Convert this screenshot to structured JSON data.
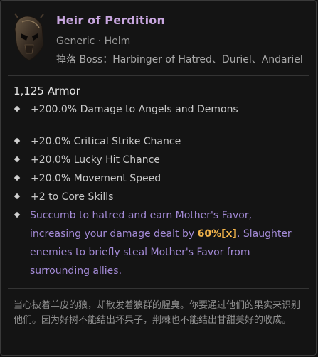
{
  "item": {
    "name": "Heir of Perdition",
    "type_line": "Generic · Helm",
    "drops_line": "掉落 Boss：Harbinger of Hatred、Duriel、Andariel",
    "icon": "helm-icon"
  },
  "stats": {
    "armor": "1,125 Armor",
    "implicit": "+200.0% Damage to Angels and Demons",
    "affixes": [
      "+20.0% Critical Strike Chance",
      "+20.0% Lucky Hit Chance",
      "+20.0% Movement Speed",
      "+2 to Core Skills"
    ],
    "aspect": {
      "before": "Succumb to hatred and earn Mother's Favor, increasing your damage dealt by ",
      "highlight": "60%[x]",
      "after": ". Slaughter enemies to briefly steal Mother's Favor from surrounding allies."
    }
  },
  "flavor_text": "当心披着羊皮的狼，却散发着狼群的腥臭。你要通过他们的果实来识别他们。因为好树不能结出坏果子，荆棘也不能结出甘甜美好的收成。",
  "colors": {
    "unique_name": "#c8a6df",
    "aspect_text": "#a38ad6",
    "aspect_highlight": "#f0b24a"
  }
}
